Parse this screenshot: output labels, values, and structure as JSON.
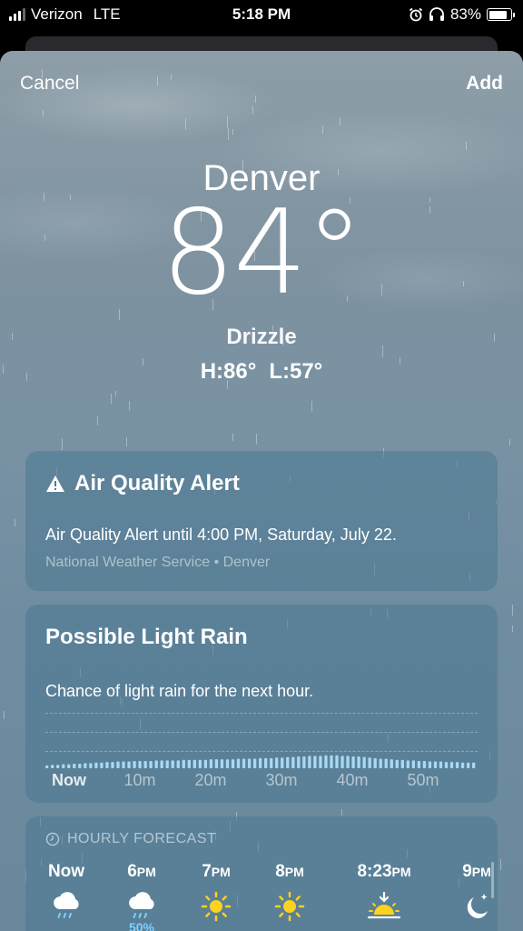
{
  "status_bar": {
    "carrier": "Verizon",
    "network": "LTE",
    "time": "5:18 PM",
    "battery": "83%",
    "battery_level": 0.83
  },
  "nav": {
    "cancel_label": "Cancel",
    "add_label": "Add"
  },
  "weather": {
    "city": "Denver",
    "temperature": "84°",
    "condition": "Drizzle",
    "high": "H:86°",
    "low": "L:57°"
  },
  "alert": {
    "title": "Air Quality Alert",
    "body": "Air Quality Alert until 4:00 PM, Saturday, July 22.",
    "source": "National Weather Service • Denver"
  },
  "rain": {
    "title": "Possible Light Rain",
    "body": "Chance of light rain for the next hour.",
    "ticks": [
      "Now",
      "10m",
      "20m",
      "30m",
      "40m",
      "50m"
    ],
    "intensity": [
      0.05,
      0.06,
      0.06,
      0.07,
      0.07,
      0.08,
      0.08,
      0.09,
      0.09,
      0.1,
      0.1,
      0.11,
      0.11,
      0.12,
      0.12,
      0.12,
      0.13,
      0.13,
      0.13,
      0.13,
      0.14,
      0.14,
      0.14,
      0.14,
      0.14,
      0.15,
      0.15,
      0.15,
      0.15,
      0.15,
      0.16,
      0.16,
      0.16,
      0.16,
      0.16,
      0.17,
      0.17,
      0.17,
      0.17,
      0.18,
      0.18,
      0.18,
      0.19,
      0.19,
      0.2,
      0.2,
      0.21,
      0.21,
      0.22,
      0.22,
      0.22,
      0.23,
      0.23,
      0.23,
      0.22,
      0.22,
      0.21,
      0.21,
      0.2,
      0.19,
      0.18,
      0.17,
      0.17,
      0.16,
      0.15,
      0.15,
      0.14,
      0.14,
      0.13,
      0.13,
      0.12,
      0.12,
      0.12,
      0.11,
      0.11,
      0.11,
      0.1,
      0.1,
      0.1
    ]
  },
  "hourly": {
    "heading": "HOURLY FORECAST",
    "hours": [
      {
        "time": "Now",
        "suffix": "",
        "icon": "rain-cloud-icon",
        "pct": ""
      },
      {
        "time": "6",
        "suffix": "PM",
        "icon": "rain-cloud-icon",
        "pct": "50%"
      },
      {
        "time": "7",
        "suffix": "PM",
        "icon": "sun-icon",
        "pct": ""
      },
      {
        "time": "8",
        "suffix": "PM",
        "icon": "sun-icon",
        "pct": ""
      },
      {
        "time": "8:23",
        "suffix": "PM",
        "icon": "sunset-icon",
        "pct": ""
      },
      {
        "time": "9",
        "suffix": "PM",
        "icon": "moon-stars-icon",
        "pct": ""
      }
    ]
  },
  "colors": {
    "rain_bar": "#a9d8f5",
    "precip_pct": "#7fd0ff",
    "sun": "#ffd21f"
  }
}
